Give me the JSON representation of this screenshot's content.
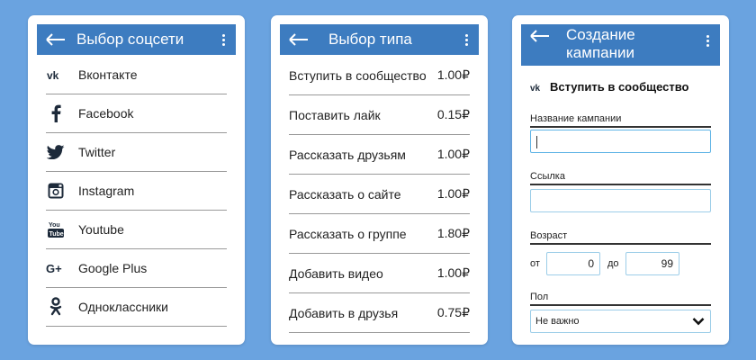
{
  "screen1": {
    "title": "Выбор соцсети",
    "items": [
      {
        "label": "Вконтакте",
        "icon": "vk-icon"
      },
      {
        "label": "Facebook",
        "icon": "facebook-icon"
      },
      {
        "label": "Twitter",
        "icon": "twitter-icon"
      },
      {
        "label": "Instagram",
        "icon": "instagram-icon"
      },
      {
        "label": "Youtube",
        "icon": "youtube-icon"
      },
      {
        "label": "Google Plus",
        "icon": "google-plus-icon"
      },
      {
        "label": "Одноклассники",
        "icon": "odnoklassniki-icon"
      }
    ]
  },
  "screen2": {
    "title": "Выбор типа",
    "items": [
      {
        "label": "Вступить в сообщество",
        "price": "1.00₽"
      },
      {
        "label": "Поставить лайк",
        "price": "0.15₽"
      },
      {
        "label": "Рассказать друзьям",
        "price": "1.00₽"
      },
      {
        "label": "Рассказать о сайте",
        "price": "1.00₽"
      },
      {
        "label": "Рассказать о группе",
        "price": "1.80₽"
      },
      {
        "label": "Добавить видео",
        "price": "1.00₽"
      },
      {
        "label": "Добавить в друзья",
        "price": "0.75₽"
      }
    ]
  },
  "screen3": {
    "title_line1": "Создание",
    "title_line2": "кампании",
    "header": "Вступить в сообщество",
    "campaign_name_label": "Название кампании",
    "campaign_name_value": "",
    "link_label": "Ссылка",
    "link_value": "",
    "age_label": "Возраст",
    "age_from_label": "от",
    "age_from_value": "0",
    "age_to_label": "до",
    "age_to_value": "99",
    "gender_label": "Пол",
    "gender_value": "Не важно"
  },
  "colors": {
    "background": "#6aa3e0",
    "appbar": "#3d7cc0",
    "card": "#ffffff",
    "input_border": "#9ccde8"
  }
}
